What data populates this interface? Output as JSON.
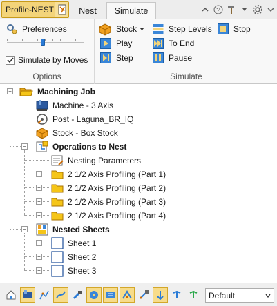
{
  "tabs": {
    "app_tab": "Profile-NEST",
    "nest": "Nest",
    "simulate": "Simulate"
  },
  "ribbon": {
    "options": {
      "preferences": "Preferences",
      "simulate_by_moves": "Simulate by Moves",
      "simulate_by_moves_checked": true,
      "group_label": "Options"
    },
    "simulate": {
      "stock": "Stock",
      "play": "Play",
      "step": "Step",
      "step_levels": "Step Levels",
      "to_end": "To End",
      "pause": "Pause",
      "stop": "Stop",
      "group_label": "Simulate"
    }
  },
  "tree": {
    "machining_job": "Machining Job",
    "machine": "Machine - 3 Axis",
    "post": "Post - Laguna_BR_IQ",
    "stock": "Stock - Box Stock",
    "operations": "Operations to Nest",
    "nesting_parameters": "Nesting Parameters",
    "op1": "2 1/2 Axis Profiling (Part 1)",
    "op2": "2 1/2 Axis Profiling (Part 2)",
    "op3": "2 1/2 Axis Profiling (Part 3)",
    "op4": "2 1/2 Axis Profiling (Part 4)",
    "nested_sheets": "Nested Sheets",
    "sheet1": "Sheet 1",
    "sheet2": "Sheet 2",
    "sheet3": "Sheet 3"
  },
  "toolbar": {
    "view_mode": "Default"
  },
  "colors": {
    "accent_gold": "#f3d47a",
    "folder_yellow": "#f5c518",
    "play_blue": "#2a7bd6"
  }
}
